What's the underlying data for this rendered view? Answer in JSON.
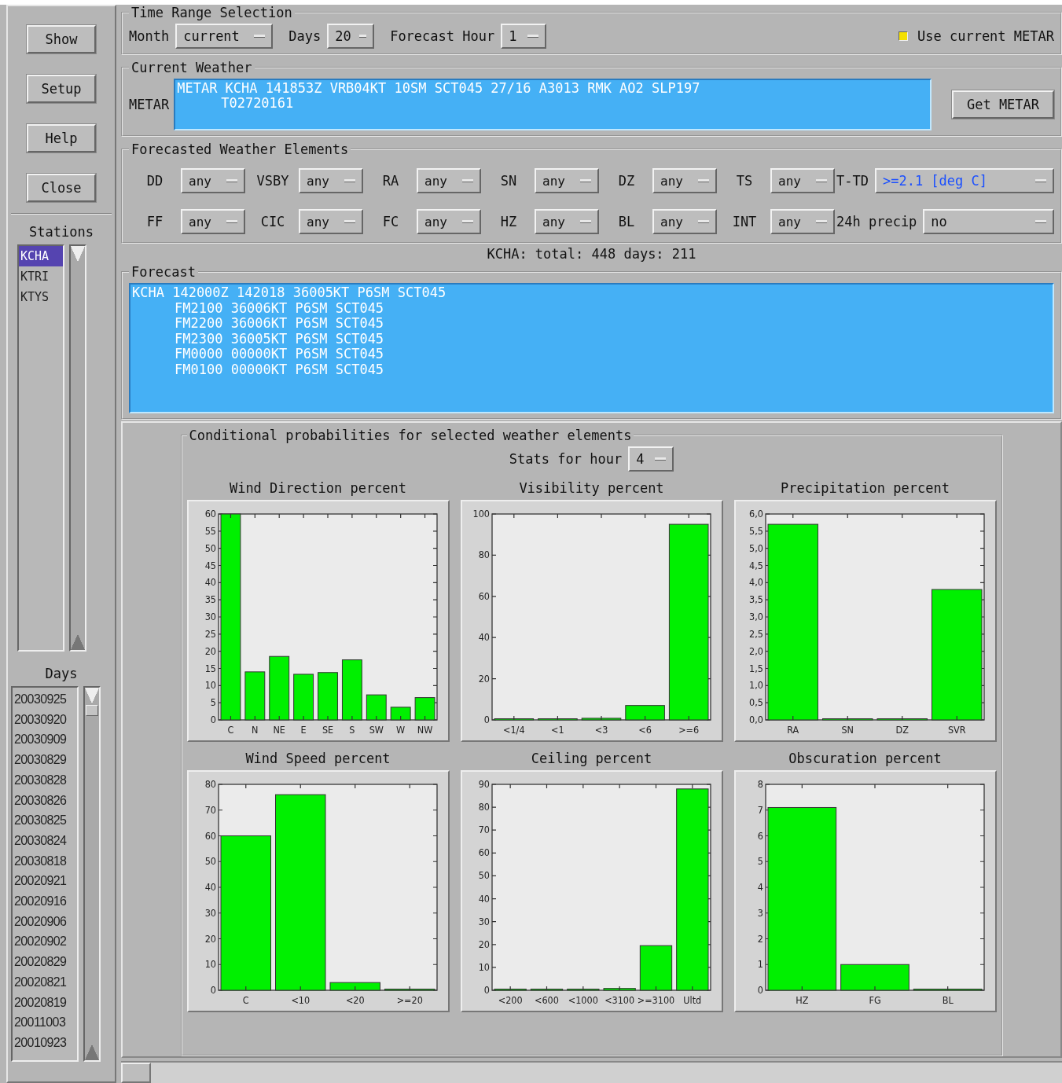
{
  "sidebar": {
    "buttons": [
      "Show",
      "Setup",
      "Help",
      "Close"
    ],
    "stations": {
      "label": "Stations",
      "items": [
        {
          "text": "KCHA",
          "selected": true
        },
        {
          "text": "KTRI",
          "selected": false
        },
        {
          "text": "KTYS",
          "selected": false
        }
      ]
    },
    "days": {
      "label": "Days",
      "items": [
        "20030925",
        "20030920",
        "20030909",
        "20030829",
        "20030828",
        "20030826",
        "20030825",
        "20030824",
        "20030818",
        "20020921",
        "20020916",
        "20020906",
        "20020902",
        "20020829",
        "20020821",
        "20020819",
        "20011003",
        "20010923"
      ]
    }
  },
  "time_range": {
    "title": "Time Range Selection",
    "menus": [
      {
        "label": "Month",
        "value": "current"
      },
      {
        "label": "Days",
        "value": "20"
      },
      {
        "label": "Forecast Hour",
        "value": "1"
      }
    ],
    "toggle": {
      "label": "Use current METAR",
      "checked": true
    }
  },
  "current_weather": {
    "title": "Current Weather",
    "label": "METAR",
    "lines": [
      {
        "kind": "header",
        "text": "METAR KCHA 141853Z VRB04KT 10SM SCT045 27/16 A3013 RMK AO2 SLP197"
      },
      {
        "kind": "continuation",
        "text": "T02720161"
      }
    ],
    "button": "Get METAR"
  },
  "elements": {
    "title": "Forecasted Weather Elements",
    "rows": [
      [
        {
          "label": "DD",
          "value": "any",
          "modified": false
        },
        {
          "label": "VSBY",
          "value": "any",
          "modified": false
        },
        {
          "label": "RA",
          "value": "any",
          "modified": false
        },
        {
          "label": "SN",
          "value": "any",
          "modified": false
        },
        {
          "label": "DZ",
          "value": "any",
          "modified": false
        },
        {
          "label": "TS",
          "value": "any",
          "modified": false
        },
        {
          "label": "T-TD",
          "value": ">=2.1 [deg C]",
          "modified": true
        }
      ],
      [
        {
          "label": "FF",
          "value": "any",
          "modified": false
        },
        {
          "label": "CIC",
          "value": "any",
          "modified": false
        },
        {
          "label": "FC",
          "value": "any",
          "modified": false
        },
        {
          "label": "HZ",
          "value": "any",
          "modified": false
        },
        {
          "label": "BL",
          "value": "any",
          "modified": false
        },
        {
          "label": "INT",
          "value": "any",
          "modified": false
        },
        {
          "label": "24h precip",
          "value": "no",
          "modified": false
        }
      ]
    ]
  },
  "summary": "KCHA: total: 448 days: 211",
  "forecast": {
    "title": "Forecast",
    "lines": [
      {
        "kind": "header",
        "text": "KCHA 142000Z 142018 36005KT P6SM SCT045"
      },
      {
        "kind": "continuation",
        "text": "FM2100 36006KT P6SM SCT045"
      },
      {
        "kind": "continuation",
        "text": "FM2200 36006KT P6SM SCT045"
      },
      {
        "kind": "continuation",
        "text": "FM2300 36005KT P6SM SCT045"
      },
      {
        "kind": "continuation",
        "text": "FM0000 00000KT P6SM SCT045"
      },
      {
        "kind": "continuation",
        "text": "FM0100 00000KT P6SM SCT045"
      }
    ]
  },
  "conditional": {
    "title": "Conditional probabilities for selected weather elements",
    "stats_menu": {
      "label": "Stats for hour",
      "value": "4"
    },
    "charts": [
      {
        "chart_data": {
          "type": "bar",
          "title": "Wind Direction percent",
          "categories": [
            "C",
            "N",
            "NE",
            "E",
            "SE",
            "S",
            "SW",
            "W",
            "NW"
          ],
          "series": [
            {
              "color": "#00f000",
              "values": [
                60,
                14,
                18.5,
                13.3,
                13.8,
                17.5,
                7.3,
                3.7,
                6.5
              ]
            }
          ],
          "ylim": [
            0,
            60
          ],
          "yticks": [
            0,
            5,
            10,
            15,
            20,
            25,
            30,
            35,
            40,
            45,
            50,
            55,
            60
          ]
        }
      },
      {
        "chart_data": {
          "type": "bar",
          "title": "Visibility percent",
          "categories": [
            "<1/4",
            "<1",
            "<3",
            "<6",
            ">=6"
          ],
          "series": [
            {
              "color": "#00f000",
              "values": [
                0,
                0,
                0.8,
                7,
                95
              ]
            }
          ],
          "ylim": [
            0,
            100
          ],
          "yticks": [
            0,
            20,
            40,
            60,
            80,
            100
          ]
        }
      },
      {
        "chart_data": {
          "type": "bar",
          "title": "Precipitation percent",
          "categories": [
            "RA",
            "SN",
            "DZ",
            "SVR"
          ],
          "series": [
            {
              "color": "#00f000",
              "values": [
                5.7,
                0,
                0,
                3.8
              ]
            }
          ],
          "ylim": [
            0,
            6
          ],
          "yticks": [
            {
              "value": 0,
              "label": "0,0"
            },
            {
              "value": 0.5,
              "label": "0,5"
            },
            {
              "value": 1,
              "label": "1,0"
            },
            {
              "value": 1.5,
              "label": "1,5"
            },
            {
              "value": 2,
              "label": "2,0"
            },
            {
              "value": 2.5,
              "label": "2,5"
            },
            {
              "value": 3,
              "label": "3,0"
            },
            {
              "value": 3.5,
              "label": "3,5"
            },
            {
              "value": 4,
              "label": "4,0"
            },
            {
              "value": 4.5,
              "label": "4,5"
            },
            {
              "value": 5,
              "label": "5,0"
            },
            {
              "value": 5.5,
              "label": "5,5"
            },
            {
              "value": 6,
              "label": "6,0"
            }
          ]
        }
      },
      {
        "chart_data": {
          "type": "bar",
          "title": "Wind Speed percent",
          "categories": [
            "C",
            "<10",
            "<20",
            ">=20"
          ],
          "series": [
            {
              "color": "#00f000",
              "values": [
                60,
                76,
                3,
                0
              ]
            }
          ],
          "ylim": [
            0,
            80
          ],
          "yticks": [
            0,
            10,
            20,
            30,
            40,
            50,
            60,
            70,
            80
          ]
        }
      },
      {
        "chart_data": {
          "type": "bar",
          "title": "Ceiling percent",
          "categories": [
            "<200",
            "<600",
            "<1000",
            "<3100",
            ">=3100",
            "Ultd"
          ],
          "series": [
            {
              "color": "#00f000",
              "values": [
                0,
                0,
                0,
                0.8,
                19.5,
                88
              ]
            }
          ],
          "ylim": [
            0,
            90
          ],
          "yticks": [
            0,
            10,
            20,
            30,
            40,
            50,
            60,
            70,
            80,
            90
          ]
        }
      },
      {
        "chart_data": {
          "type": "bar",
          "title": "Obscuration percent",
          "categories": [
            "HZ",
            "FG",
            "BL"
          ],
          "series": [
            {
              "color": "#00f000",
              "values": [
                7.1,
                1,
                0
              ]
            }
          ],
          "ylim": [
            0,
            8
          ],
          "yticks": [
            0,
            1,
            2,
            3,
            4,
            5,
            6,
            7,
            8
          ]
        }
      }
    ]
  }
}
